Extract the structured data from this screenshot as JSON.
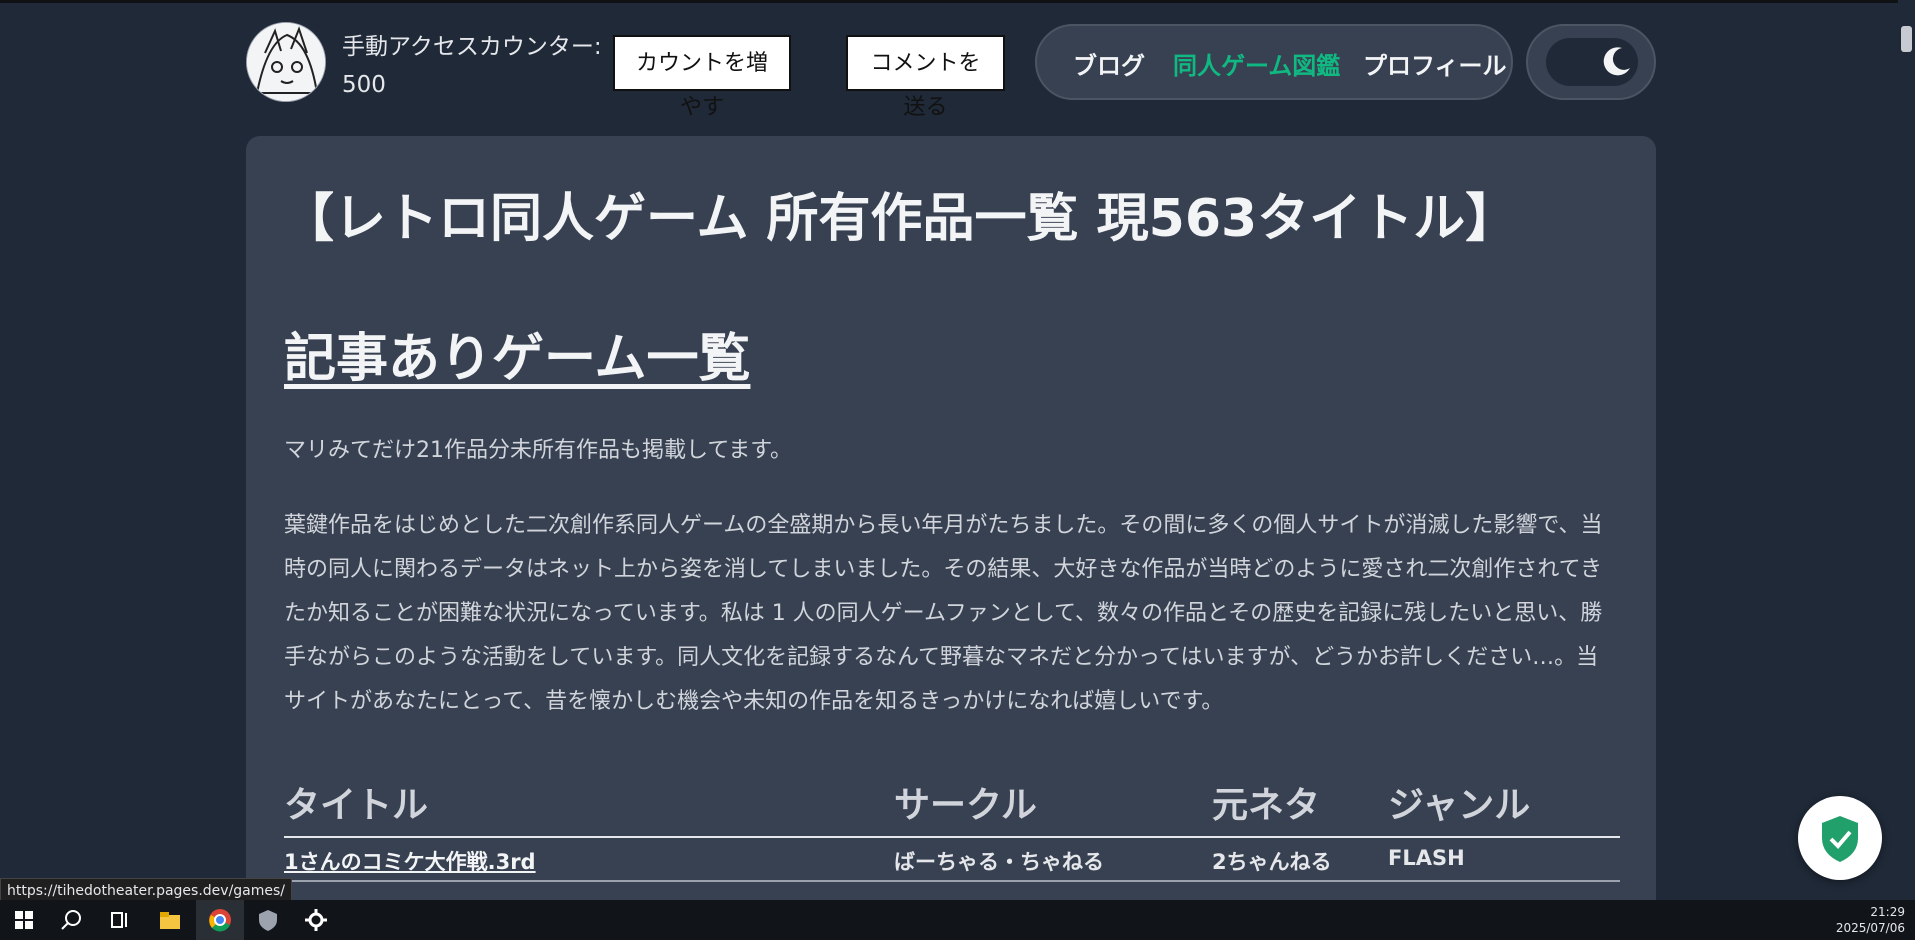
{
  "header": {
    "counter_label": "手動アクセスカウンター:",
    "counter_value": "500",
    "count_button": {
      "line1": "カウントを増",
      "line2": "やす"
    },
    "comment_button": {
      "line1": "コメントを",
      "line2": "送る"
    },
    "nav": [
      {
        "label": "ブログ",
        "active": false
      },
      {
        "label": "同人ゲーム図鑑",
        "active": true
      },
      {
        "label": "プロフィール",
        "active": false
      }
    ],
    "theme_toggle_icon": "moon-stars-icon"
  },
  "main": {
    "title": "【レトロ同人ゲーム 所有作品一覧 現563タイトル】",
    "section_heading": "記事ありゲーム一覧",
    "note": "マリみてだけ21作品分未所有作品も掲載してます。",
    "intro": "葉鍵作品をはじめとした二次創作系同人ゲームの全盛期から長い年月がたちました。その間に多くの個人サイトが消滅した影響で、当時の同人に関わるデータはネット上から姿を消してしまいました。その結果、大好きな作品が当時どのように愛され二次創作されてきたか知ることが困難な状況になっています。私は 1 人の同人ゲームファンとして、数々の作品とその歴史を記録に残したいと思い、勝手ながらこのような活動をしています。同人文化を記録するなんて野暮なマネだと分かってはいますが、どうかお許しください…。当サイトがあなたにとって、昔を懐かしむ機会や未知の作品を知るきっかけになれば嬉しいです。",
    "table": {
      "headers": [
        "タイトル",
        "サークル",
        "元ネタ",
        "ジャンル"
      ],
      "rows": [
        [
          "1さんのコミケ大作戦.3rd",
          "ばーちゃる・ちゃねる",
          "2ちゃんねる",
          "FLASH"
        ]
      ]
    }
  },
  "status_url": "https://tihedotheater.pages.dev/games/",
  "taskbar": {
    "clock_time": "21:29",
    "clock_date": "2025/07/06"
  },
  "colors": {
    "background": "#1f2937",
    "card": "#374151",
    "accent": "#10b981"
  }
}
